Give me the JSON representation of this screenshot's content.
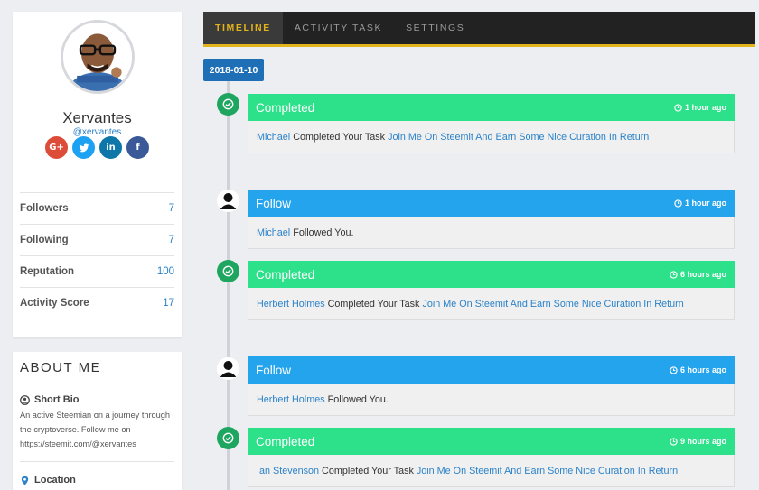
{
  "profile": {
    "name": "Xervantes",
    "handle": "@xervantes",
    "socials": [
      {
        "name": "google-plus",
        "label": "G+",
        "color": "#dd4b39"
      },
      {
        "name": "twitter",
        "label": "t",
        "color": "#1da1f2"
      },
      {
        "name": "linkedin",
        "label": "in",
        "color": "#0e76a8"
      },
      {
        "name": "facebook",
        "label": "f",
        "color": "#3b5998"
      }
    ],
    "stats": [
      {
        "label": "Followers",
        "value": "7"
      },
      {
        "label": "Following",
        "value": "7"
      },
      {
        "label": "Reputation",
        "value": "100"
      },
      {
        "label": "Activity Score",
        "value": "17"
      }
    ]
  },
  "about": {
    "title": "ABOUT ME",
    "bio_label": "Short Bio",
    "bio_text": "An active Steemian on a journey through the cryptoverse. Follow me on https://steemit.com/@xervantes",
    "location_label": "Location"
  },
  "tabs": [
    {
      "label": "TIMELINE",
      "active": true
    },
    {
      "label": "ACTIVITY TASK",
      "active": false
    },
    {
      "label": "SETTINGS",
      "active": false
    }
  ],
  "timeline": {
    "date": "2018-01-10",
    "items": [
      {
        "type": "Completed",
        "time": "1 hour ago",
        "user": "Michael",
        "text": " Completed Your Task ",
        "task": "Join Me On Steemit And Earn Some Nice Curation In Return"
      },
      {
        "type": "Follow",
        "time": "1 hour ago",
        "user": "Michael",
        "text": " Followed You.",
        "task": ""
      },
      {
        "type": "Completed",
        "time": "6 hours ago",
        "user": "Herbert Holmes",
        "text": " Completed Your Task ",
        "task": "Join Me On Steemit And Earn Some Nice Curation In Return"
      },
      {
        "type": "Follow",
        "time": "6 hours ago",
        "user": "Herbert Holmes",
        "text": " Followed You.",
        "task": ""
      },
      {
        "type": "Completed",
        "time": "9 hours ago",
        "user": "Ian Stevenson",
        "text": " Completed Your Task ",
        "task": "Join Me On Steemit And Earn Some Nice Curation In Return"
      }
    ]
  },
  "colors": {
    "completed": "#2de08a",
    "follow": "#25a4ee",
    "accent": "#e2b31a",
    "date_badge": "#1f6fb6",
    "link": "#2b82c9"
  }
}
